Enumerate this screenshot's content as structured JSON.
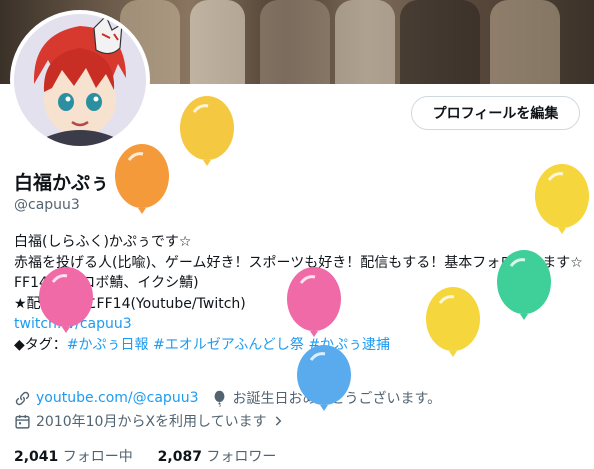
{
  "profile": {
    "name": "白福かぷぅ",
    "name_suffix": "☆",
    "handle": "@capuu3",
    "edit_button": "プロフィールを編集",
    "bio": {
      "line1": "白福(しらふく)かぷぅです☆",
      "line2": "赤福を投げる人(比喩)、ゲーム好き！スポーツも好き！配信もする！基本フォロバします☆",
      "line3": "FF14(チョコボ鯖、イクシ鯖)",
      "line4": "★配信：主にFF14(Youtube/Twitch)",
      "link": "twitch.tv/capuu3",
      "tags_prefix": "◆タグ：",
      "tags": [
        "#かぷぅ日報",
        "#エオルゼアふんどし祭",
        "#かぷぅ逮捕"
      ]
    },
    "website": "youtube.com/@capuu3",
    "birthday_text": "お誕生日おめでとうございます。",
    "joined": "2010年10月からXを利用しています",
    "following_count": "2,041",
    "following_label": "フォロー中",
    "followers_count": "2,087",
    "followers_label": "フォロワー"
  },
  "colors": {
    "link": "#1d9bf0",
    "secondary_text": "#536471",
    "balloons": [
      "#f5c842",
      "#f59a3a",
      "#f06aa8",
      "#5aabee",
      "#f5d63d",
      "#3fcf99"
    ]
  },
  "icons": [
    "link-icon",
    "balloon-location-icon",
    "calendar-icon",
    "chevron-right-icon"
  ]
}
